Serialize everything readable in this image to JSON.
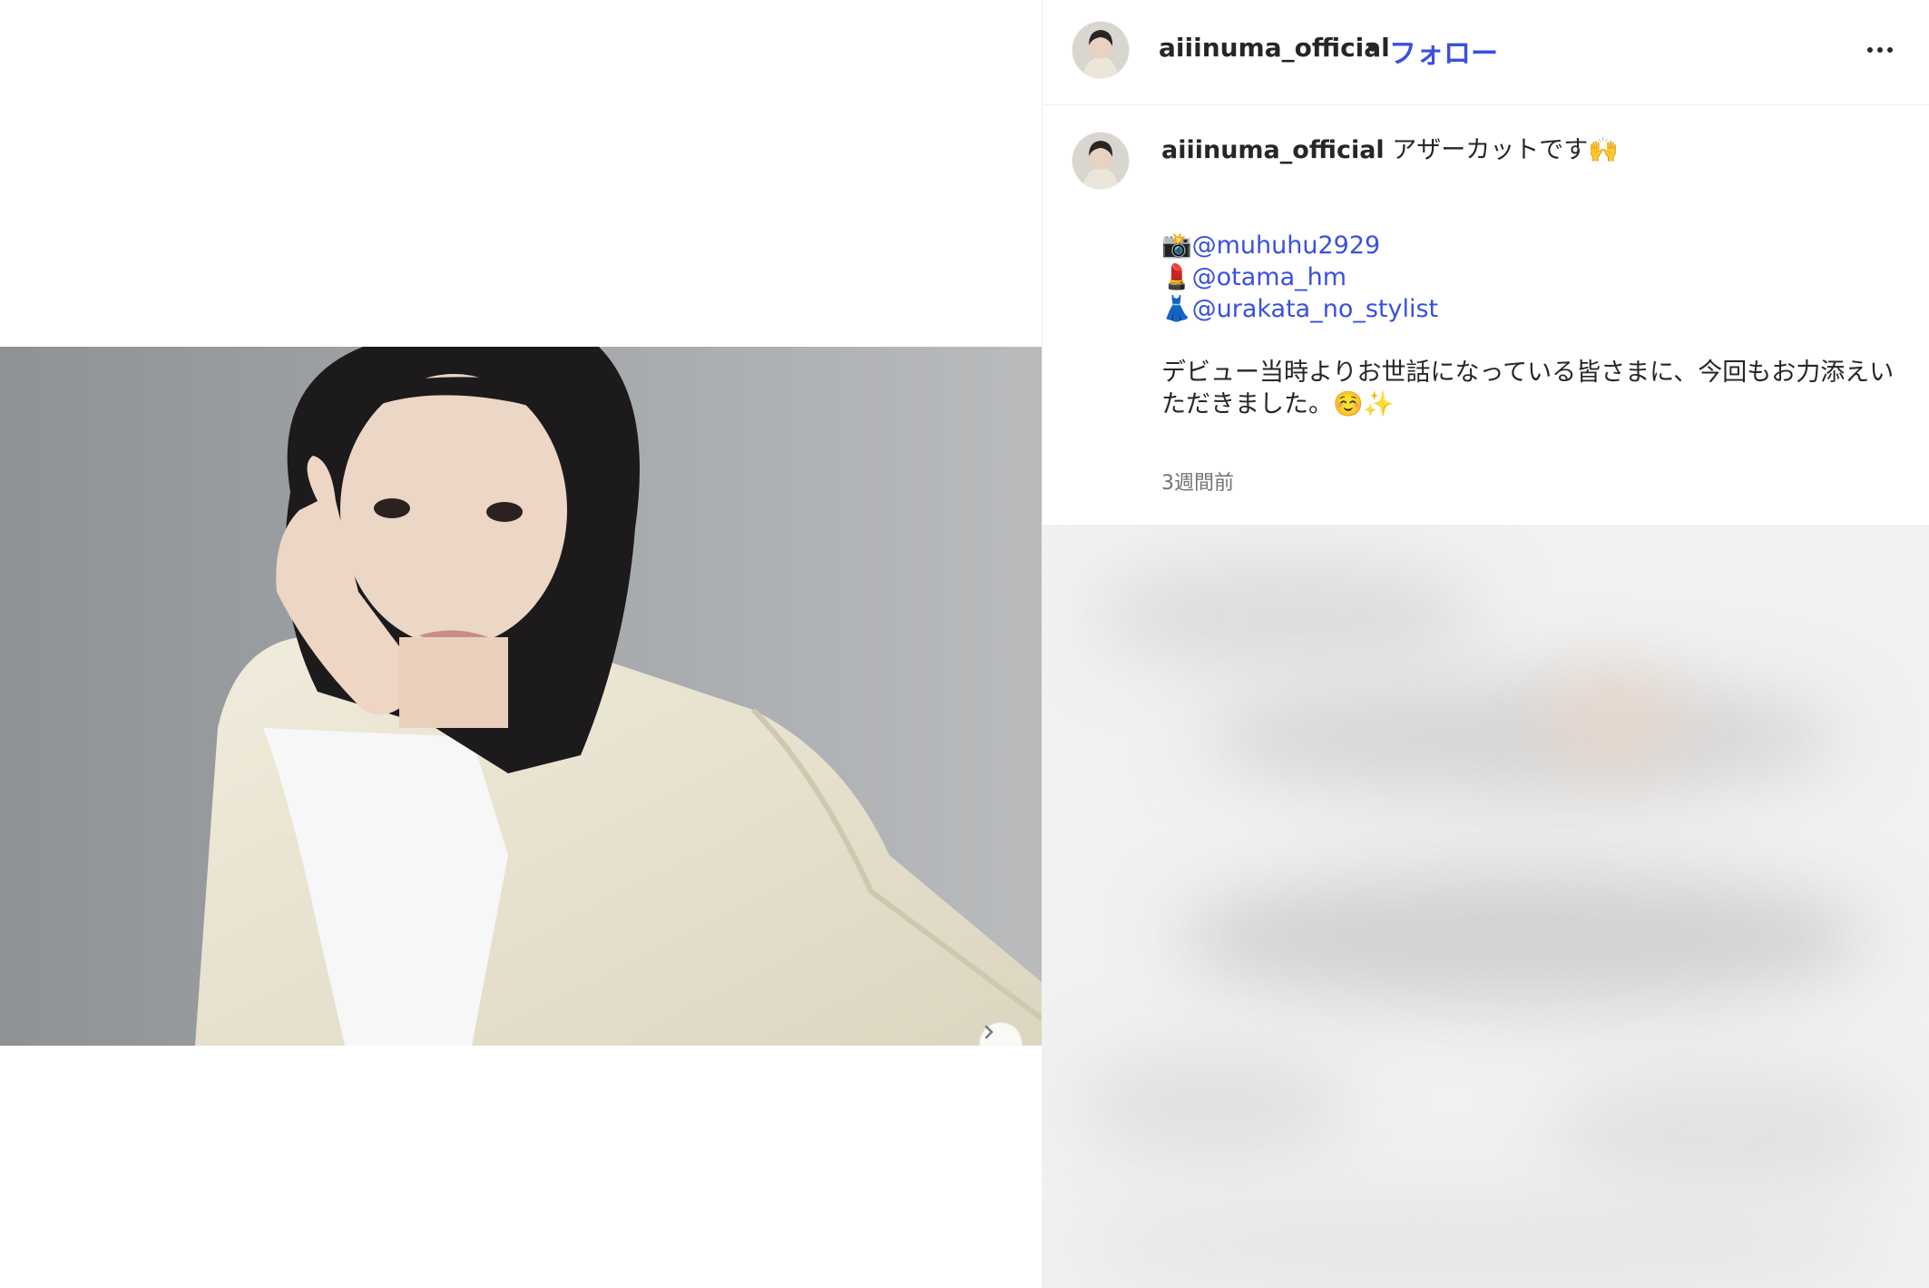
{
  "post": {
    "username": "aiiinuma_official",
    "separator": "•",
    "follow_label": "フォロー",
    "more_options_icon": "more-horizontal-icon",
    "next_icon": "chevron-right-icon"
  },
  "caption": {
    "username": "aiiinuma_official",
    "title": "アザーカットです",
    "title_emoji": "🙌",
    "credits": [
      {
        "emoji": "📸",
        "handle": "@muhuhu2929"
      },
      {
        "emoji": "💄",
        "handle": "@otama_hm"
      },
      {
        "emoji": "👗",
        "handle": "@urakata_no_stylist"
      }
    ],
    "body": "デビュー当時よりお世話になっている皆さまに、今回もお力添えいただきました。",
    "body_emojis": "☺️✨",
    "timestamp": "3週間前"
  },
  "colors": {
    "link": "#3a50e0",
    "text": "#262626",
    "muted": "#737373",
    "divider": "#efefef"
  }
}
